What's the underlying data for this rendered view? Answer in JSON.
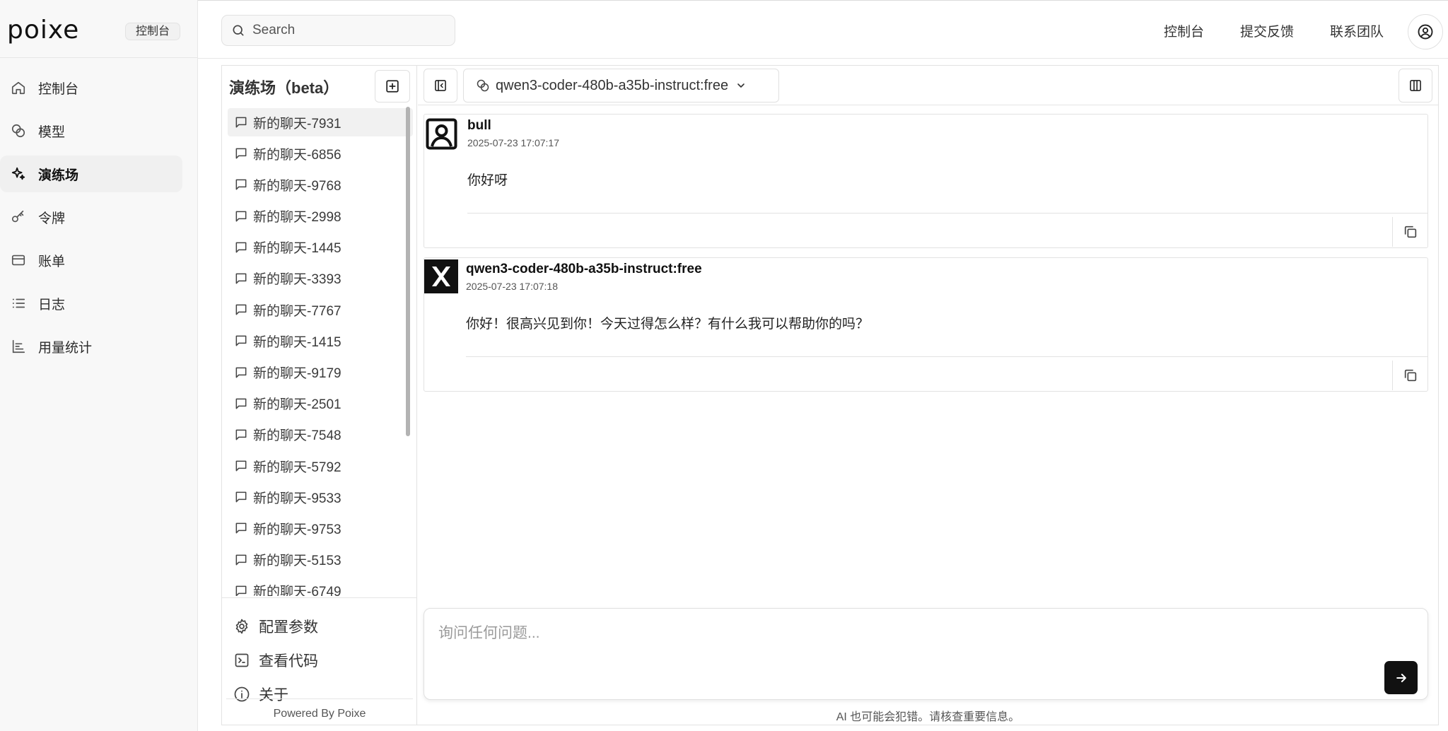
{
  "app": {
    "logo_text": "poixe",
    "logo_badge": "控制台"
  },
  "nav": [
    {
      "label": "控制台",
      "icon": "home-icon",
      "active": false
    },
    {
      "label": "模型",
      "icon": "models-icon",
      "active": false
    },
    {
      "label": "演练场",
      "icon": "sparkle-icon",
      "active": true
    },
    {
      "label": "令牌",
      "icon": "key-icon",
      "active": false
    },
    {
      "label": "账单",
      "icon": "credit-card-icon",
      "active": false
    },
    {
      "label": "日志",
      "icon": "list-icon",
      "active": false
    },
    {
      "label": "用量统计",
      "icon": "bar-chart-icon",
      "active": false
    }
  ],
  "header": {
    "search_placeholder": "Search",
    "links": [
      "控制台",
      "提交反馈",
      "联系团队"
    ],
    "account_icon": "user-circle-icon"
  },
  "playground": {
    "title": "演练场（beta）",
    "new_chat_icon": "plus-square-icon",
    "chats": [
      "新的聊天-7931",
      "新的聊天-6856",
      "新的聊天-9768",
      "新的聊天-2998",
      "新的聊天-1445",
      "新的聊天-3393",
      "新的聊天-7767",
      "新的聊天-1415",
      "新的聊天-9179",
      "新的聊天-2501",
      "新的聊天-7548",
      "新的聊天-5792",
      "新的聊天-9533",
      "新的聊天-9753",
      "新的聊天-5153",
      "新的聊天-6749"
    ],
    "selected_chat": 0,
    "options": [
      {
        "label": "配置参数",
        "icon": "gear-icon"
      },
      {
        "label": "查看代码",
        "icon": "terminal-icon"
      },
      {
        "label": "关于",
        "icon": "info-icon"
      }
    ],
    "powered_by": "Powered By Poixe"
  },
  "toolbar": {
    "collapse_icon": "panel-collapse-icon",
    "model": "qwen3-coder-480b-a35b-instruct:free",
    "layout_icon": "columns-icon"
  },
  "messages": [
    {
      "author": "bull",
      "time": "2025-07-23 17:07:17",
      "text": "你好呀",
      "avatar": "user-avatar-icon"
    },
    {
      "author": "qwen3-coder-480b-a35b-instruct:free",
      "time": "2025-07-23 17:07:18",
      "text": "你好！很高兴见到你！今天过得怎么样？有什么我可以帮助你的吗？",
      "avatar": "x-logo-icon"
    }
  ],
  "composer": {
    "placeholder": "询问任何问题...",
    "send_icon": "arrow-right-icon"
  },
  "disclaimer": "AI 也可能会犯错。请核查重要信息。"
}
